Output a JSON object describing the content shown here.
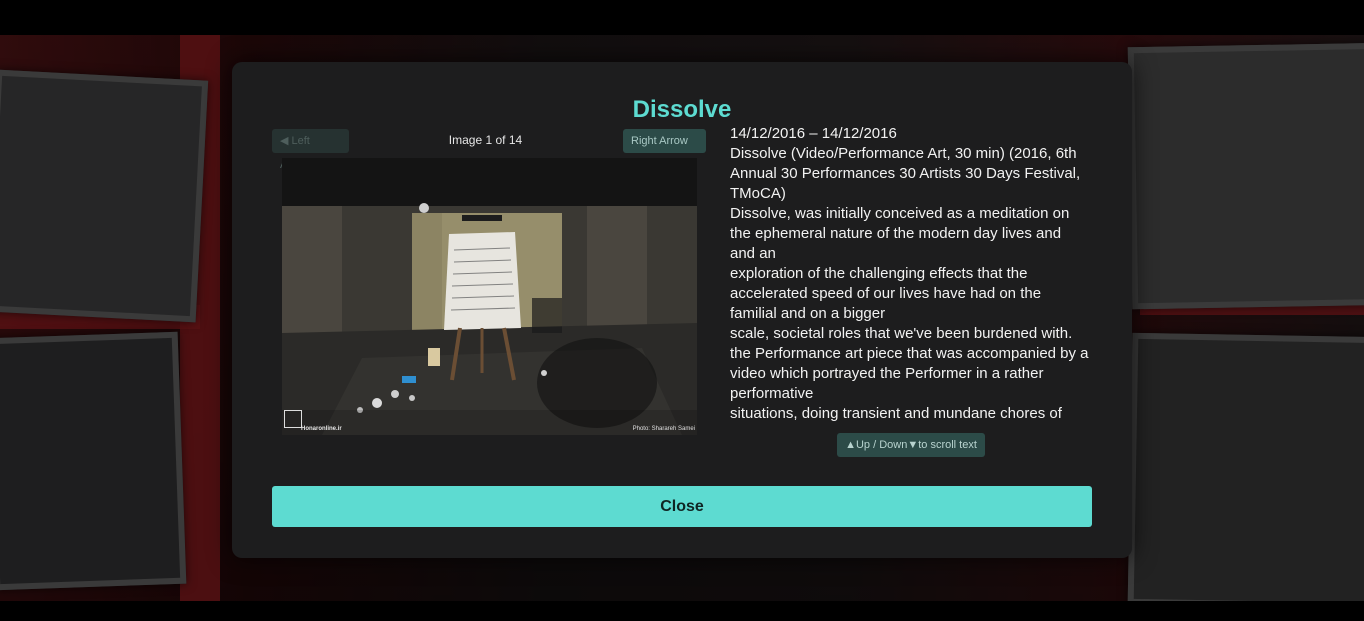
{
  "modal": {
    "title": "Dissolve",
    "nav": {
      "left_label": "◀ Left Arrow",
      "right_label": "Right Arrow ▶",
      "counter": "Image 1 of 14"
    },
    "photo": {
      "watermark_left": "Honaronline.ir",
      "credit": "Photo: Sharareh Samei"
    },
    "description": {
      "dates": "14/12/2016 – 14/12/2016",
      "work": "Dissolve (Video/Performance Art, 30 min) (2016, 6th Annual 30 Performances 30 Artists 30 Days Festival, TMoCA)",
      "para1": "Dissolve, was initially conceived as a meditation on the ephemeral nature of the modern day lives and and an",
      "para2": "exploration of the challenging effects that the accelerated speed of our lives have had on the familial and on a bigger",
      "para3": "scale, societal roles that we've been burdened with. the Performance art piece that was accompanied by a video which portrayed the Performer in a rather performative",
      "para4": "situations, doing transient and mundane chores of"
    },
    "scroll_hint": "▲Up / Down▼to scroll text",
    "close_label": "Close"
  },
  "colors": {
    "accent": "#5ddbd1",
    "modal_bg": "#1d1d1e",
    "button_dark": "#2c4b48"
  }
}
